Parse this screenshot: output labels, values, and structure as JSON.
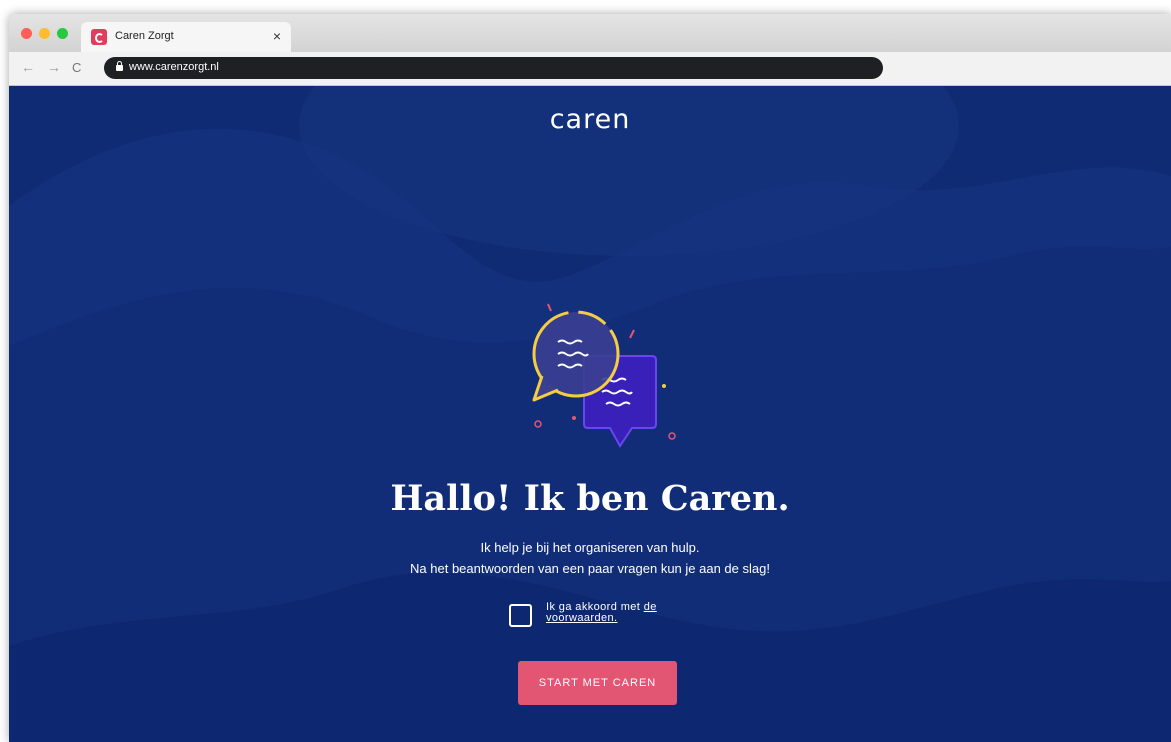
{
  "browser": {
    "tab": {
      "title": "Caren Zorgt",
      "close_glyph": "×",
      "favicon": "caren-favicon-icon"
    },
    "nav": {
      "back": "←",
      "forward": "→",
      "reload": "C"
    },
    "address": {
      "url": "www.carenzorgt.nl"
    }
  },
  "page": {
    "logo": "caren",
    "headline": "Hallo! Ik ben Caren.",
    "intro_line1": "Ik help je bij het organiseren van hulp.",
    "intro_line2": "Na het beantwoorden van een paar vragen kun je aan de slag!",
    "consent": {
      "text": "Ik ga akkoord met ",
      "link_text": "de voorwaarden.",
      "checked": false
    },
    "start_button": "START MET CAREN",
    "illustration": "chat-bubbles-illustration"
  },
  "colors": {
    "background": "#0f2b74",
    "accent_button": "#e25673",
    "bubble_yellow": "#f4cd43",
    "bubble_purple": "#5b2de0"
  }
}
